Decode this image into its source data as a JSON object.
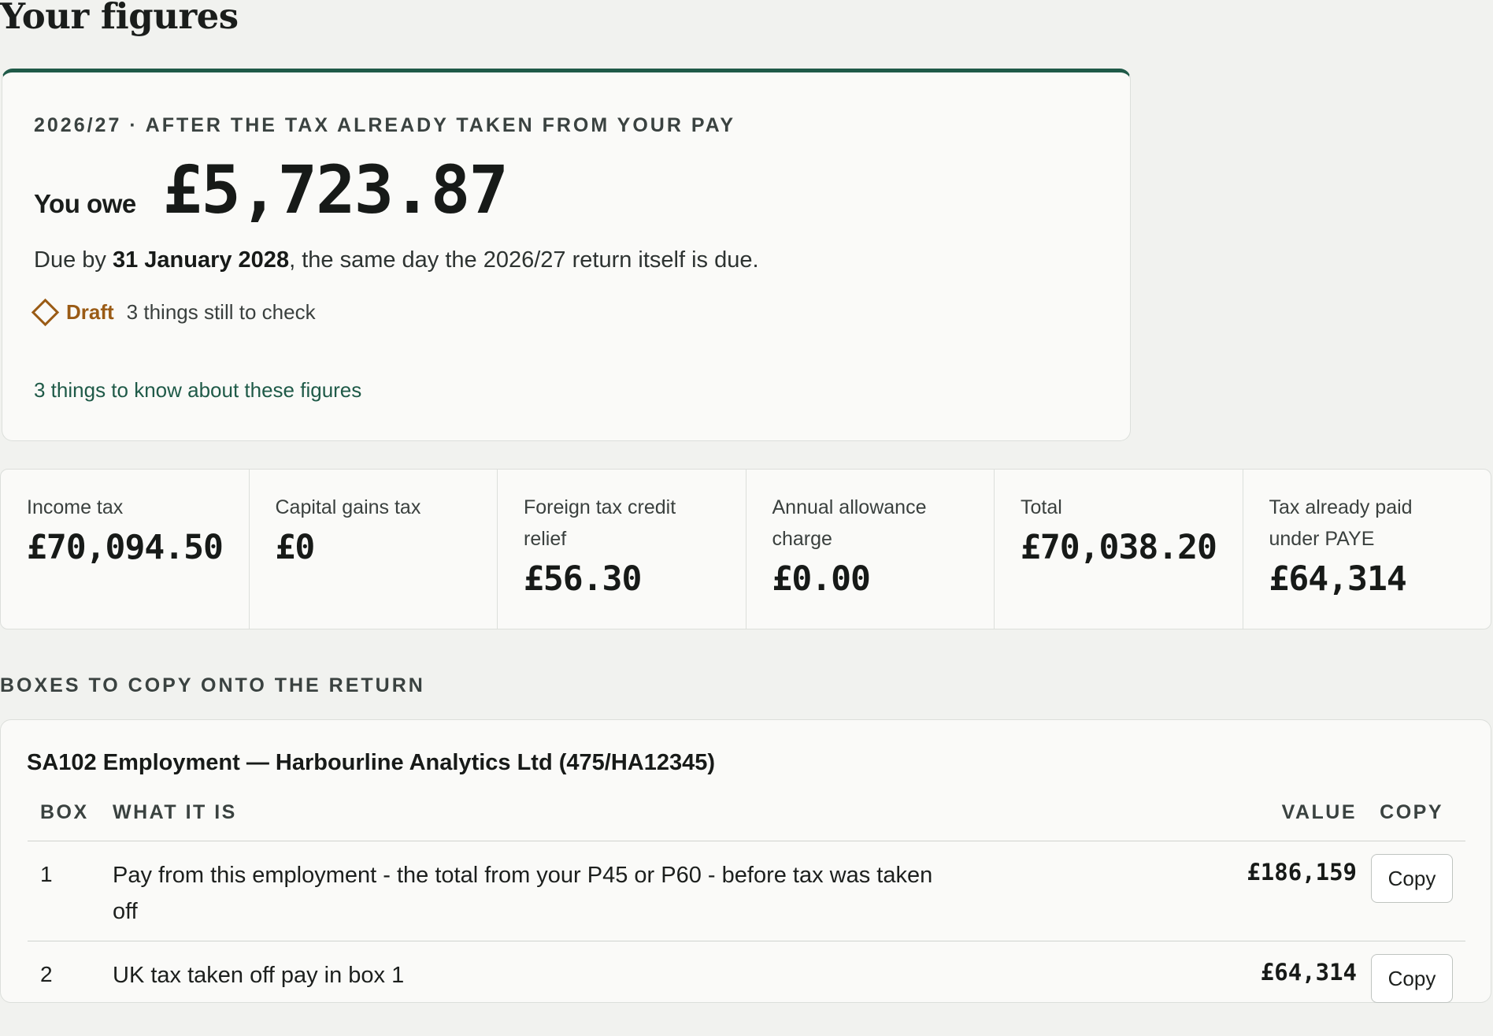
{
  "page": {
    "title": "Your figures"
  },
  "summary": {
    "eyebrow": "2026/27 · after the tax already taken from your pay",
    "owe_label": "You owe",
    "owe_amount": "£5,723.87",
    "due_prefix": "Due by ",
    "due_date": "31 January 2028",
    "due_suffix": ", the same day the 2026/27 return itself is due.",
    "status_label": "Draft",
    "status_note": "3 things still to check",
    "know_link": "3 things to know about these figures"
  },
  "stats": [
    {
      "label": "Income tax",
      "value": "£70,094.50"
    },
    {
      "label": "Capital gains tax",
      "value": "£0"
    },
    {
      "label": "Foreign tax credit relief",
      "value": "£56.30"
    },
    {
      "label": "Annual allowance charge",
      "value": "£0.00"
    },
    {
      "label": "Total",
      "value": "£70,038.20"
    },
    {
      "label": "Tax already paid under PAYE",
      "value": "£64,314"
    }
  ],
  "boxes": {
    "section_heading": "Boxes to copy onto the return",
    "title": "SA102 Employment — Harbourline Analytics Ltd (475/HA12345)",
    "columns": {
      "box": "Box",
      "what": "What it is",
      "value": "Value",
      "copy": "Copy"
    },
    "rows": [
      {
        "box": "1",
        "what": "Pay from this employment - the total from your P45 or P60 - before tax was taken off",
        "value": "£186,159",
        "copy_label": "Copy"
      },
      {
        "box": "2",
        "what": "UK tax taken off pay in box 1",
        "value": "£64,314",
        "copy_label": "Copy"
      }
    ]
  },
  "colors": {
    "accent": "#1f5a48",
    "draft": "#9a5b15",
    "background": "#f1f2ef",
    "card": "#fafaf8"
  }
}
